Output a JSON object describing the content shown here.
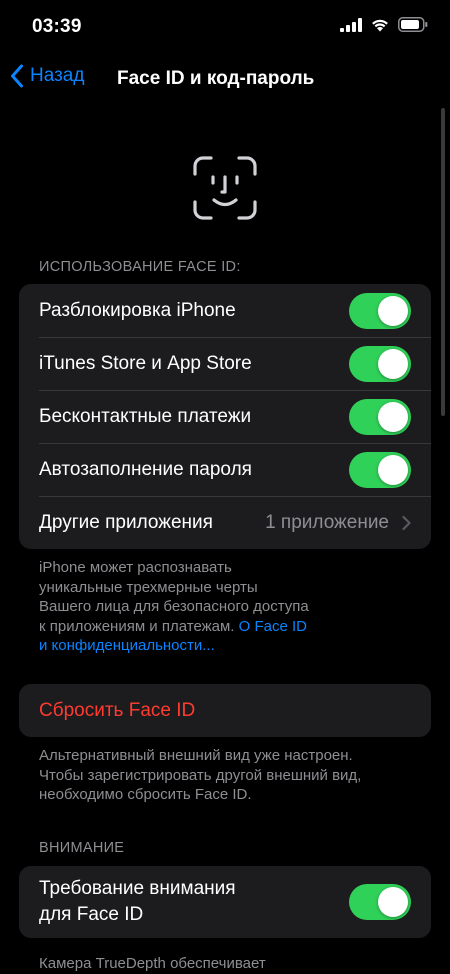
{
  "status_bar": {
    "time": "03:39"
  },
  "nav": {
    "back_label": "Назад",
    "title": "Face ID и код-пароль"
  },
  "face_id_section": {
    "header": "ИСПОЛЬЗОВАНИЕ FACE ID:",
    "rows": [
      {
        "label": "Разблокировка iPhone",
        "toggle_on": true
      },
      {
        "label": "iTunes Store и App Store",
        "toggle_on": true
      },
      {
        "label": "Бесконтактные платежи",
        "toggle_on": true
      },
      {
        "label": "Автозаполнение пароля",
        "toggle_on": true
      }
    ],
    "other_apps": {
      "label": "Другие приложения",
      "value": "1 приложение"
    },
    "footer_lines": [
      "iPhone может распознавать",
      "уникальные трехмерные черты",
      "Вашего лица для безопасного доступа",
      "к приложениям и платежам."
    ],
    "footer_link_inline": "О Face ID",
    "footer_link_line2": "и конфиденциальности..."
  },
  "reset": {
    "label": "Сбросить Face ID",
    "footer_lines": [
      "Альтернативный внешний вид уже настроен.",
      "Чтобы зарегистрировать другой внешний вид,",
      "необходимо сбросить Face ID."
    ]
  },
  "attention_section": {
    "header": "ВНИМАНИЕ",
    "row_label_line1": "Требование внимания",
    "row_label_line2": "для Face ID",
    "toggle_on": true,
    "footer_partial": "Камера TrueDepth обеспечивает"
  },
  "colors": {
    "accent": "#0a84ff",
    "toggle_on": "#30d158",
    "destructive": "#ff3b30",
    "cell_bg": "#1c1c1e",
    "secondary_text": "#8e8e93"
  },
  "icons": {
    "back": "chevron-left-icon",
    "face_id": "face-id-icon",
    "disclosure": "chevron-right-icon",
    "signal": "cellular-signal-icon",
    "wifi": "wifi-icon",
    "battery": "battery-icon"
  }
}
